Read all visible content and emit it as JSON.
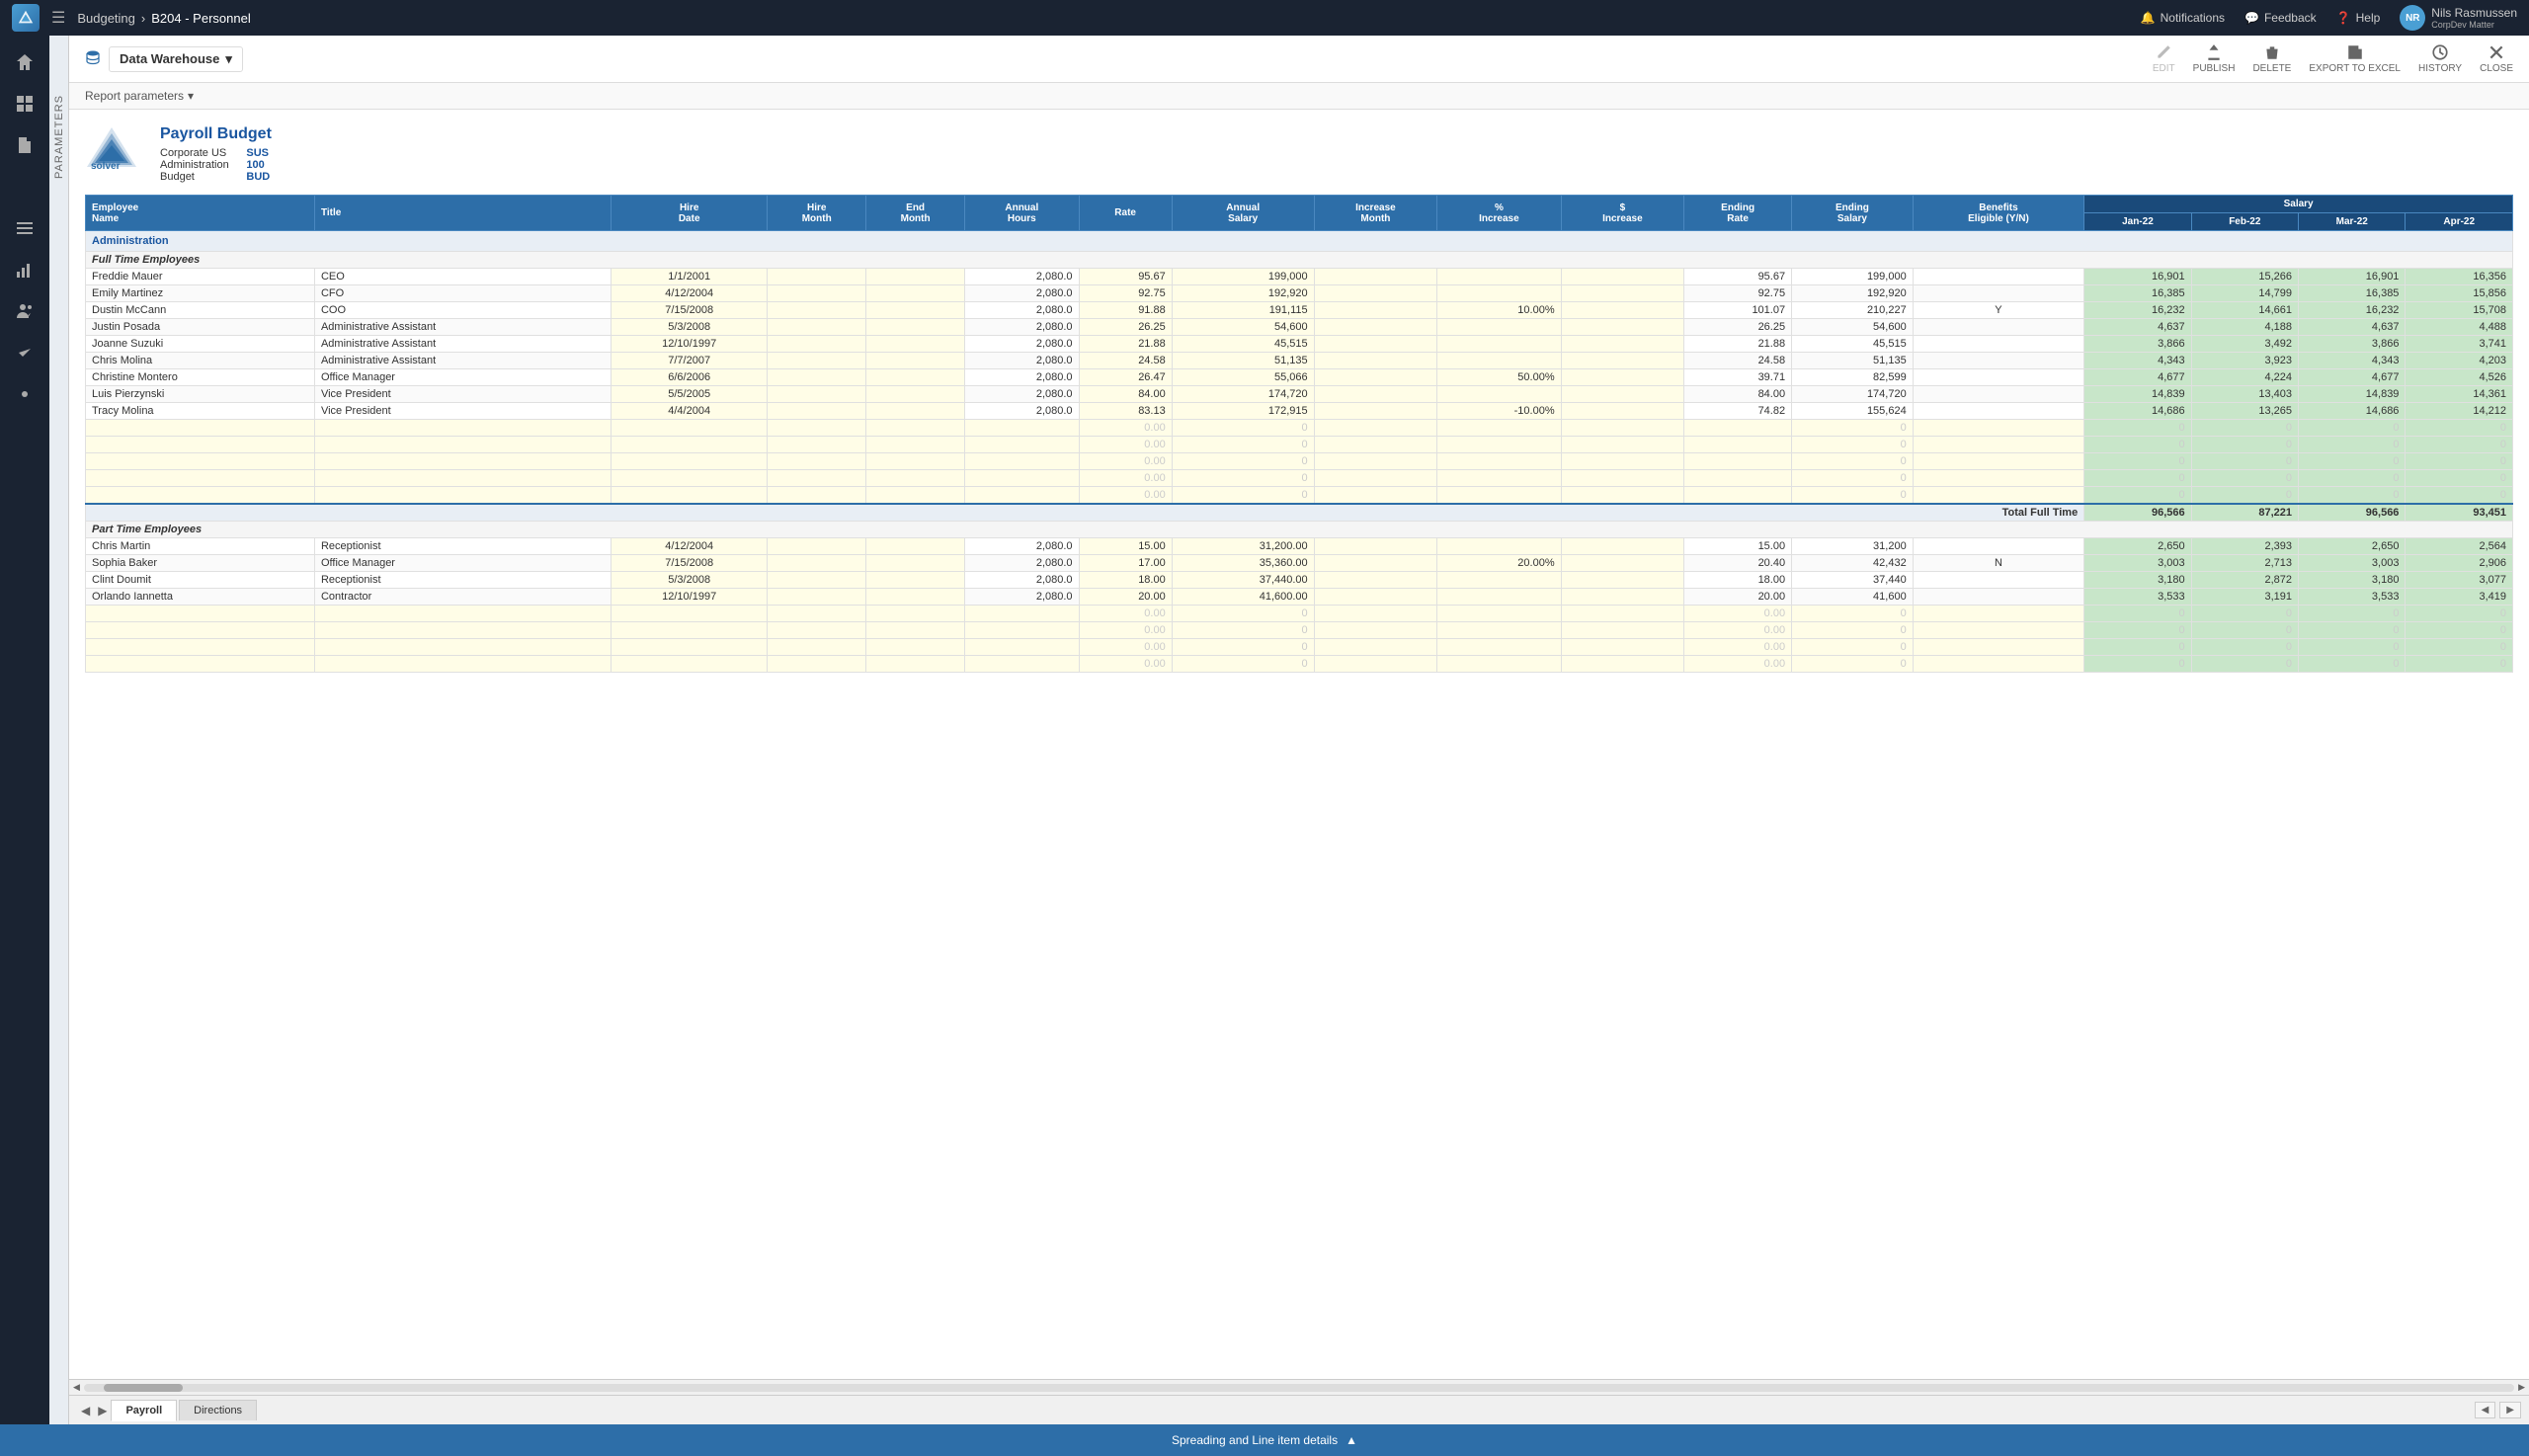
{
  "topbar": {
    "breadcrumb_parent": "Budgeting",
    "breadcrumb_sep": "›",
    "breadcrumb_current": "B204 - Personnel",
    "notifications_label": "Notifications",
    "feedback_label": "Feedback",
    "help_label": "Help",
    "user_name": "Nils Rasmussen",
    "user_org": "CorpDev Matter",
    "user_initials": "NR"
  },
  "toolbar": {
    "warehouse_label": "Data Warehouse",
    "edit_label": "EDIT",
    "publish_label": "PUBLISH",
    "delete_label": "DELETE",
    "export_label": "EXPORT TO EXCEL",
    "history_label": "HISTORY",
    "close_label": "CLOSE"
  },
  "report_params": {
    "label": "Report parameters"
  },
  "report": {
    "title": "Payroll Budget",
    "company_label": "Corporate US",
    "company_code": "SUS",
    "dept_label": "Administration",
    "dept_code": "100",
    "budget_label": "Budget",
    "budget_code": "BUD"
  },
  "table": {
    "headers": [
      "Employee Name",
      "Title",
      "Hire Date",
      "Hire Month",
      "End Month",
      "Annual Hours",
      "Rate",
      "Annual Salary",
      "Increase Month",
      "% Increase",
      "$ Increase",
      "Ending Rate",
      "Ending Salary",
      "Benefits Eligible (Y/N)",
      "Salary Jan-22",
      "Salary Feb-22",
      "Salary Mar-22",
      "Salary Apr-22"
    ],
    "section_administration": "Administration",
    "section_full_time": "Full Time Employees",
    "full_time_employees": [
      {
        "name": "Freddie Mauer",
        "title": "CEO",
        "hire_date": "1/1/2001",
        "hire_month": "",
        "end_month": "",
        "annual_hours": "2,080.0",
        "rate": "95.67",
        "annual_salary": "199,000",
        "inc_month": "",
        "pct_inc": "",
        "dollar_inc": "",
        "end_rate": "95.67",
        "end_salary": "199,000",
        "benefits": "",
        "jan22": "16,901",
        "feb22": "15,266",
        "mar22": "16,901",
        "apr22": "16,356"
      },
      {
        "name": "Emily Martinez",
        "title": "CFO",
        "hire_date": "4/12/2004",
        "hire_month": "",
        "end_month": "",
        "annual_hours": "2,080.0",
        "rate": "92.75",
        "annual_salary": "192,920",
        "inc_month": "",
        "pct_inc": "",
        "dollar_inc": "",
        "end_rate": "92.75",
        "end_salary": "192,920",
        "benefits": "",
        "jan22": "16,385",
        "feb22": "14,799",
        "mar22": "16,385",
        "apr22": "15,856"
      },
      {
        "name": "Dustin McCann",
        "title": "COO",
        "hire_date": "7/15/2008",
        "hire_month": "",
        "end_month": "",
        "annual_hours": "2,080.0",
        "rate": "91.88",
        "annual_salary": "191,115",
        "inc_month": "",
        "pct_inc": "10.00%",
        "dollar_inc": "",
        "end_rate": "101.07",
        "end_salary": "210,227",
        "benefits": "Y",
        "jan22": "16,232",
        "feb22": "14,661",
        "mar22": "16,232",
        "apr22": "15,708"
      },
      {
        "name": "Justin Posada",
        "title": "Administrative Assistant",
        "hire_date": "5/3/2008",
        "hire_month": "",
        "end_month": "",
        "annual_hours": "2,080.0",
        "rate": "26.25",
        "annual_salary": "54,600",
        "inc_month": "",
        "pct_inc": "",
        "dollar_inc": "",
        "end_rate": "26.25",
        "end_salary": "54,600",
        "benefits": "",
        "jan22": "4,637",
        "feb22": "4,188",
        "mar22": "4,637",
        "apr22": "4,488"
      },
      {
        "name": "Joanne Suzuki",
        "title": "Administrative Assistant",
        "hire_date": "12/10/1997",
        "hire_month": "",
        "end_month": "",
        "annual_hours": "2,080.0",
        "rate": "21.88",
        "annual_salary": "45,515",
        "inc_month": "",
        "pct_inc": "",
        "dollar_inc": "",
        "end_rate": "21.88",
        "end_salary": "45,515",
        "benefits": "",
        "jan22": "3,866",
        "feb22": "3,492",
        "mar22": "3,866",
        "apr22": "3,741"
      },
      {
        "name": "Chris Molina",
        "title": "Administrative Assistant",
        "hire_date": "7/7/2007",
        "hire_month": "",
        "end_month": "",
        "annual_hours": "2,080.0",
        "rate": "24.58",
        "annual_salary": "51,135",
        "inc_month": "",
        "pct_inc": "",
        "dollar_inc": "",
        "end_rate": "24.58",
        "end_salary": "51,135",
        "benefits": "",
        "jan22": "4,343",
        "feb22": "3,923",
        "mar22": "4,343",
        "apr22": "4,203"
      },
      {
        "name": "Christine Montero",
        "title": "Office Manager",
        "hire_date": "6/6/2006",
        "hire_month": "",
        "end_month": "",
        "annual_hours": "2,080.0",
        "rate": "26.47",
        "annual_salary": "55,066",
        "inc_month": "",
        "pct_inc": "50.00%",
        "dollar_inc": "",
        "end_rate": "39.71",
        "end_salary": "82,599",
        "benefits": "",
        "jan22": "4,677",
        "feb22": "4,224",
        "mar22": "4,677",
        "apr22": "4,526"
      },
      {
        "name": "Luis Pierzynski",
        "title": "Vice President",
        "hire_date": "5/5/2005",
        "hire_month": "",
        "end_month": "",
        "annual_hours": "2,080.0",
        "rate": "84.00",
        "annual_salary": "174,720",
        "inc_month": "",
        "pct_inc": "",
        "dollar_inc": "",
        "end_rate": "84.00",
        "end_salary": "174,720",
        "benefits": "",
        "jan22": "14,839",
        "feb22": "13,403",
        "mar22": "14,839",
        "apr22": "14,361"
      },
      {
        "name": "Tracy Molina",
        "title": "Vice President",
        "hire_date": "4/4/2004",
        "hire_month": "",
        "end_month": "",
        "annual_hours": "2,080.0",
        "rate": "83.13",
        "annual_salary": "172,915",
        "inc_month": "",
        "pct_inc": "-10.00%",
        "dollar_inc": "",
        "end_rate": "74.82",
        "end_salary": "155,624",
        "benefits": "",
        "jan22": "14,686",
        "feb22": "13,265",
        "mar22": "14,686",
        "apr22": "14,212"
      }
    ],
    "empty_rows_ft": [
      {
        "rate": "0.00",
        "salary": "0",
        "end_rate": "",
        "end_salary": "0",
        "jan22": "0",
        "feb22": "0",
        "mar22": "0",
        "apr22": "0"
      },
      {
        "rate": "0.00",
        "salary": "0",
        "end_rate": "",
        "end_salary": "0",
        "jan22": "0",
        "feb22": "0",
        "mar22": "0",
        "apr22": "0"
      },
      {
        "rate": "0.00",
        "salary": "0",
        "end_rate": "",
        "end_salary": "0",
        "jan22": "0",
        "feb22": "0",
        "mar22": "0",
        "apr22": "0"
      },
      {
        "rate": "0.00",
        "salary": "0",
        "end_rate": "",
        "end_salary": "0",
        "jan22": "0",
        "feb22": "0",
        "mar22": "0",
        "apr22": "0"
      },
      {
        "rate": "0.00",
        "salary": "0",
        "end_rate": "",
        "end_salary": "0",
        "jan22": "0",
        "feb22": "0",
        "mar22": "0",
        "apr22": "0"
      }
    ],
    "total_full_time_label": "Total Full Time",
    "total_full_time": {
      "jan22": "96,566",
      "feb22": "87,221",
      "mar22": "96,566",
      "apr22": "93,451"
    },
    "section_part_time": "Part Time Employees",
    "part_time_employees": [
      {
        "name": "Chris Martin",
        "title": "Receptionist",
        "hire_date": "4/12/2004",
        "hire_month": "",
        "end_month": "",
        "annual_hours": "2,080.0",
        "rate": "15.00",
        "annual_salary": "31,200.00",
        "inc_month": "",
        "pct_inc": "",
        "dollar_inc": "",
        "end_rate": "15.00",
        "end_salary": "31,200",
        "benefits": "",
        "jan22": "2,650",
        "feb22": "2,393",
        "mar22": "2,650",
        "apr22": "2,564"
      },
      {
        "name": "Sophia Baker",
        "title": "Office Manager",
        "hire_date": "7/15/2008",
        "hire_month": "",
        "end_month": "",
        "annual_hours": "2,080.0",
        "rate": "17.00",
        "annual_salary": "35,360.00",
        "inc_month": "",
        "pct_inc": "20.00%",
        "dollar_inc": "",
        "end_rate": "20.40",
        "end_salary": "42,432",
        "benefits": "N",
        "jan22": "3,003",
        "feb22": "2,713",
        "mar22": "3,003",
        "apr22": "2,906"
      },
      {
        "name": "Clint Doumit",
        "title": "Receptionist",
        "hire_date": "5/3/2008",
        "hire_month": "",
        "end_month": "",
        "annual_hours": "2,080.0",
        "rate": "18.00",
        "annual_salary": "37,440.00",
        "inc_month": "",
        "pct_inc": "",
        "dollar_inc": "",
        "end_rate": "18.00",
        "end_salary": "37,440",
        "benefits": "",
        "jan22": "3,180",
        "feb22": "2,872",
        "mar22": "3,180",
        "apr22": "3,077"
      },
      {
        "name": "Orlando Iannetta",
        "title": "Contractor",
        "hire_date": "12/10/1997",
        "hire_month": "",
        "end_month": "",
        "annual_hours": "2,080.0",
        "rate": "20.00",
        "annual_salary": "41,600.00",
        "inc_month": "",
        "pct_inc": "",
        "dollar_inc": "",
        "end_rate": "20.00",
        "end_salary": "41,600",
        "benefits": "",
        "jan22": "3,533",
        "feb22": "3,191",
        "mar22": "3,533",
        "apr22": "3,419"
      }
    ],
    "empty_rows_pt": [
      {
        "rate": "0.00",
        "salary": "0",
        "jan22": "0",
        "feb22": "0",
        "mar22": "0",
        "apr22": "0"
      },
      {
        "rate": "0.00",
        "salary": "0",
        "jan22": "0",
        "feb22": "0",
        "mar22": "0",
        "apr22": "0"
      },
      {
        "rate": "0.00",
        "salary": "0",
        "jan22": "0",
        "feb22": "0",
        "mar22": "0",
        "apr22": "0"
      },
      {
        "rate": "0.00",
        "salary": "0",
        "jan22": "0",
        "feb22": "0",
        "mar22": "0",
        "apr22": "0"
      }
    ]
  },
  "tabs": {
    "active": "Payroll",
    "items": [
      "Payroll",
      "Directions"
    ]
  },
  "bottom_bar": {
    "label": "Spreading and Line item details",
    "icon": "▲"
  },
  "params_panel": {
    "label": "Parameters"
  }
}
